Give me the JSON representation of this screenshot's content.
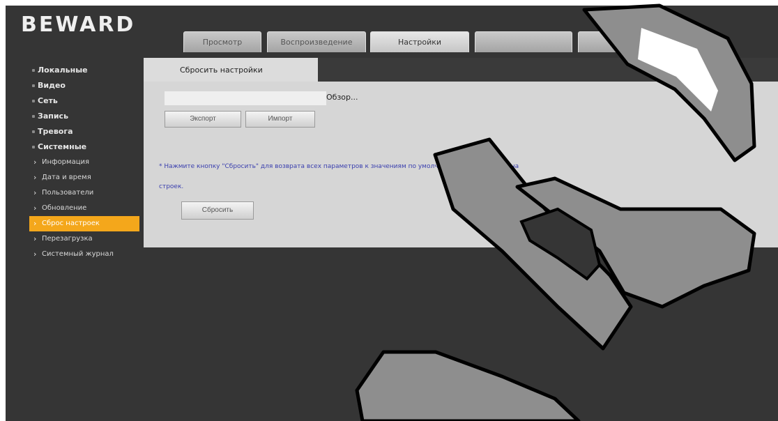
{
  "brand": {
    "logo_text": "BEWARD"
  },
  "tabs": [
    {
      "label": "Просмотр",
      "active": false
    },
    {
      "label": "Воспроизведение",
      "active": false
    },
    {
      "label": "Настройки",
      "active": true
    },
    {
      "label": "",
      "active": false
    },
    {
      "label": "",
      "active": false
    }
  ],
  "sidebar": {
    "items": [
      {
        "label": "Локальные"
      },
      {
        "label": "Видео"
      },
      {
        "label": "Сеть"
      },
      {
        "label": "Запись"
      },
      {
        "label": "Тревога"
      },
      {
        "label": "Системные"
      }
    ],
    "subitems": [
      {
        "label": "Информация"
      },
      {
        "label": "Дата и время"
      },
      {
        "label": "Пользователи"
      },
      {
        "label": "Обновление"
      },
      {
        "label": "Сброс настроек"
      },
      {
        "label": "Перезагрузка"
      },
      {
        "label": "Системный журнал"
      }
    ]
  },
  "panel": {
    "tab_label": "Сбросить настройки",
    "file_input": {
      "value": "",
      "placeholder": ""
    },
    "browse_label": "Обзор...",
    "export_label": "Экспорт",
    "import_label": "Импорт",
    "note_text": "* Нажмите кнопку \"Сбросить\" для возврата всех параметров к значениям по умолчанию, кроме сетевых настроек.",
    "reset_label": "Сбросить"
  },
  "colors": {
    "background": "#353535",
    "panel": "#d6d6d6",
    "active_menu": "#f4a71b",
    "note_text": "#3a3fae",
    "watermark": "#8e8e8e"
  }
}
